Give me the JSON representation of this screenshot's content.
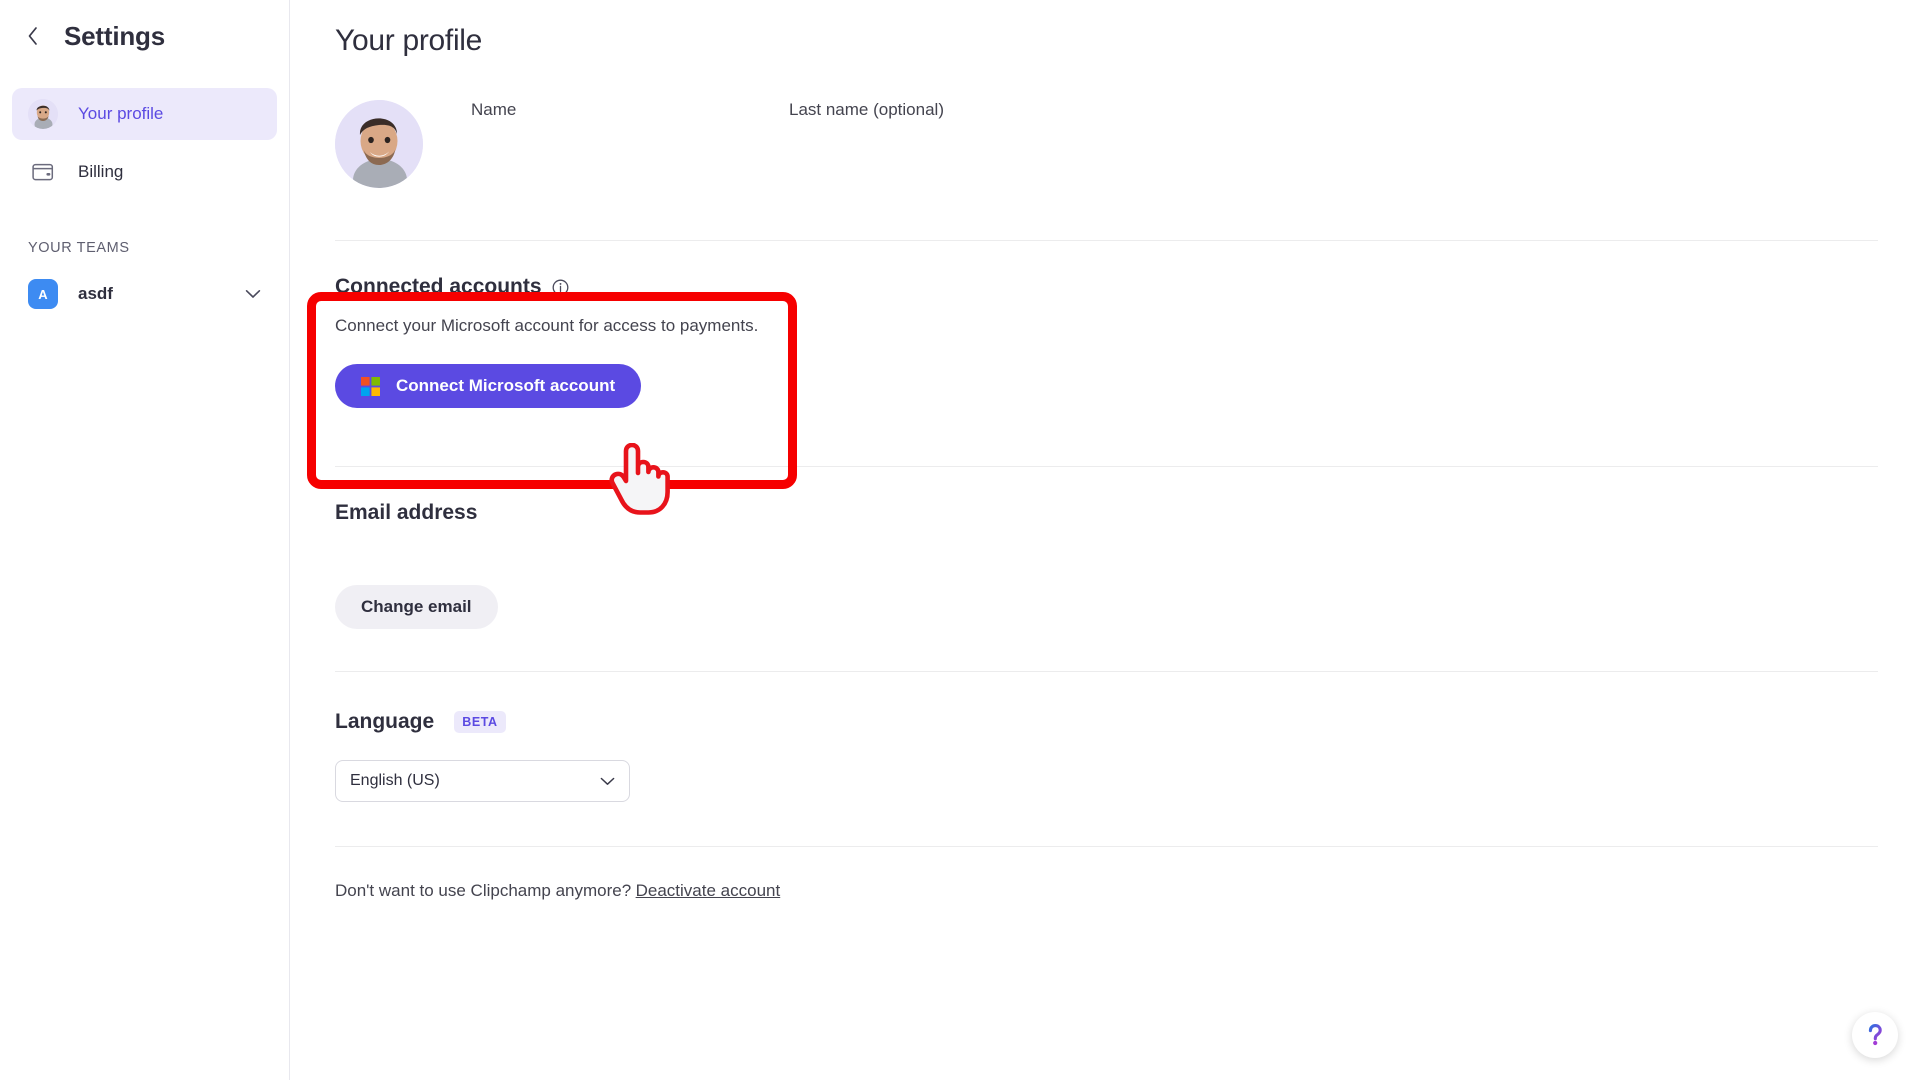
{
  "sidebar": {
    "back_icon": "chevron-left-icon",
    "title": "Settings",
    "items": [
      {
        "label": "Your profile",
        "icon": "user-avatar-icon",
        "active": true
      },
      {
        "label": "Billing",
        "icon": "wallet-icon",
        "active": false
      }
    ],
    "teams_section_title": "YOUR TEAMS",
    "teams": [
      {
        "initial": "A",
        "name": "asdf",
        "chevron": "chevron-down-icon",
        "badge_color": "#3d8bf2"
      }
    ]
  },
  "main": {
    "page_title": "Your profile",
    "profile": {
      "avatar": "profile-photo",
      "name_label": "Name",
      "name_value": "",
      "lastname_label": "Last name (optional)",
      "lastname_value": ""
    },
    "connected_accounts": {
      "title": "Connected accounts",
      "info_icon": "info-circle-icon",
      "description": "Connect your Microsoft account for access to payments.",
      "button_label": "Connect Microsoft account",
      "button_icon": "microsoft-logo-icon",
      "button_color": "#5b4ae2"
    },
    "email": {
      "title": "Email address",
      "value": "",
      "change_button_label": "Change email"
    },
    "language": {
      "title": "Language",
      "badge": "BETA",
      "selected": "English (US)",
      "chevron": "chevron-down-icon"
    },
    "footer": {
      "text": "Don't want to use Clipchamp anymore?",
      "link_label": "Deactivate account"
    }
  },
  "overlay": {
    "highlight_color": "#f60000",
    "cursor_icon": "pointing-hand-cursor"
  },
  "help": {
    "icon": "question-mark-icon",
    "label": "Help"
  }
}
